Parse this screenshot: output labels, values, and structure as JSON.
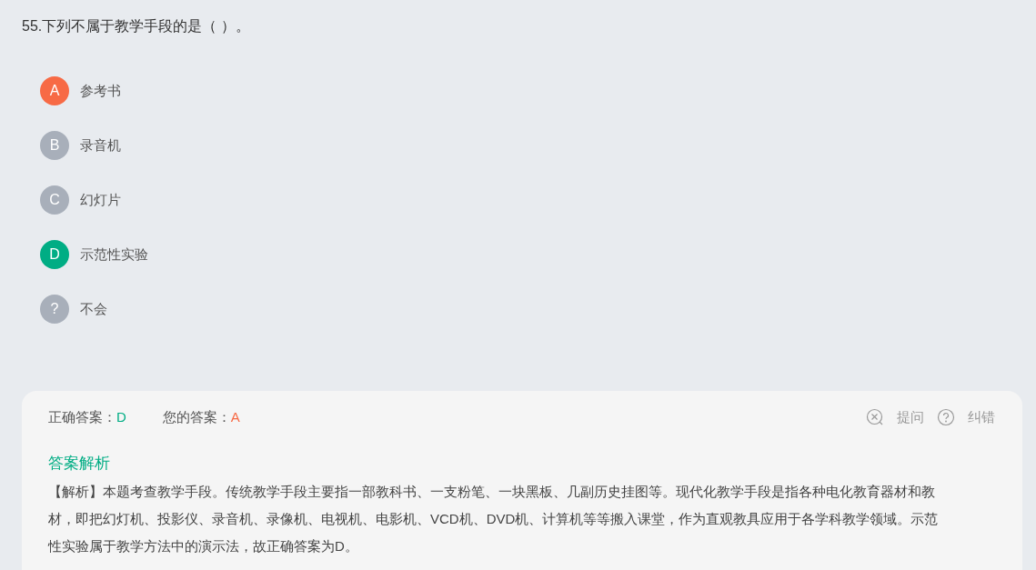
{
  "question": "55.下列不属于教学手段的是（   ）。",
  "options": [
    {
      "letter": "A",
      "text": "参考书",
      "selected": true,
      "correct": false
    },
    {
      "letter": "B",
      "text": "录音机",
      "selected": false,
      "correct": false
    },
    {
      "letter": "C",
      "text": "幻灯片",
      "selected": false,
      "correct": false
    },
    {
      "letter": "D",
      "text": "示范性实验",
      "selected": false,
      "correct": true
    },
    {
      "letter": "?",
      "text": "不会",
      "selected": false,
      "correct": false
    }
  ],
  "answer_panel": {
    "correct_label": "正确答案：",
    "correct_value": "D",
    "your_label": "您的答案：",
    "your_value": "A",
    "ask_button": "提问",
    "report_button": "纠错",
    "analysis_title": "答案解析",
    "analysis": "【解析】本题考查教学手段。传统教学手段主要指一部教科书、一支粉笔、一块黑板、几副历史挂图等。现代化教学手段是指各种电化教育器材和教材，即把幻灯机、投影仪、录音机、录像机、电视机、电影机、VCD机、DVD机、计算机等等搬入课堂，作为直观教具应用于各学科教学领域。示范性实验属于教学方法中的演示法，故正确答案为D。"
  }
}
